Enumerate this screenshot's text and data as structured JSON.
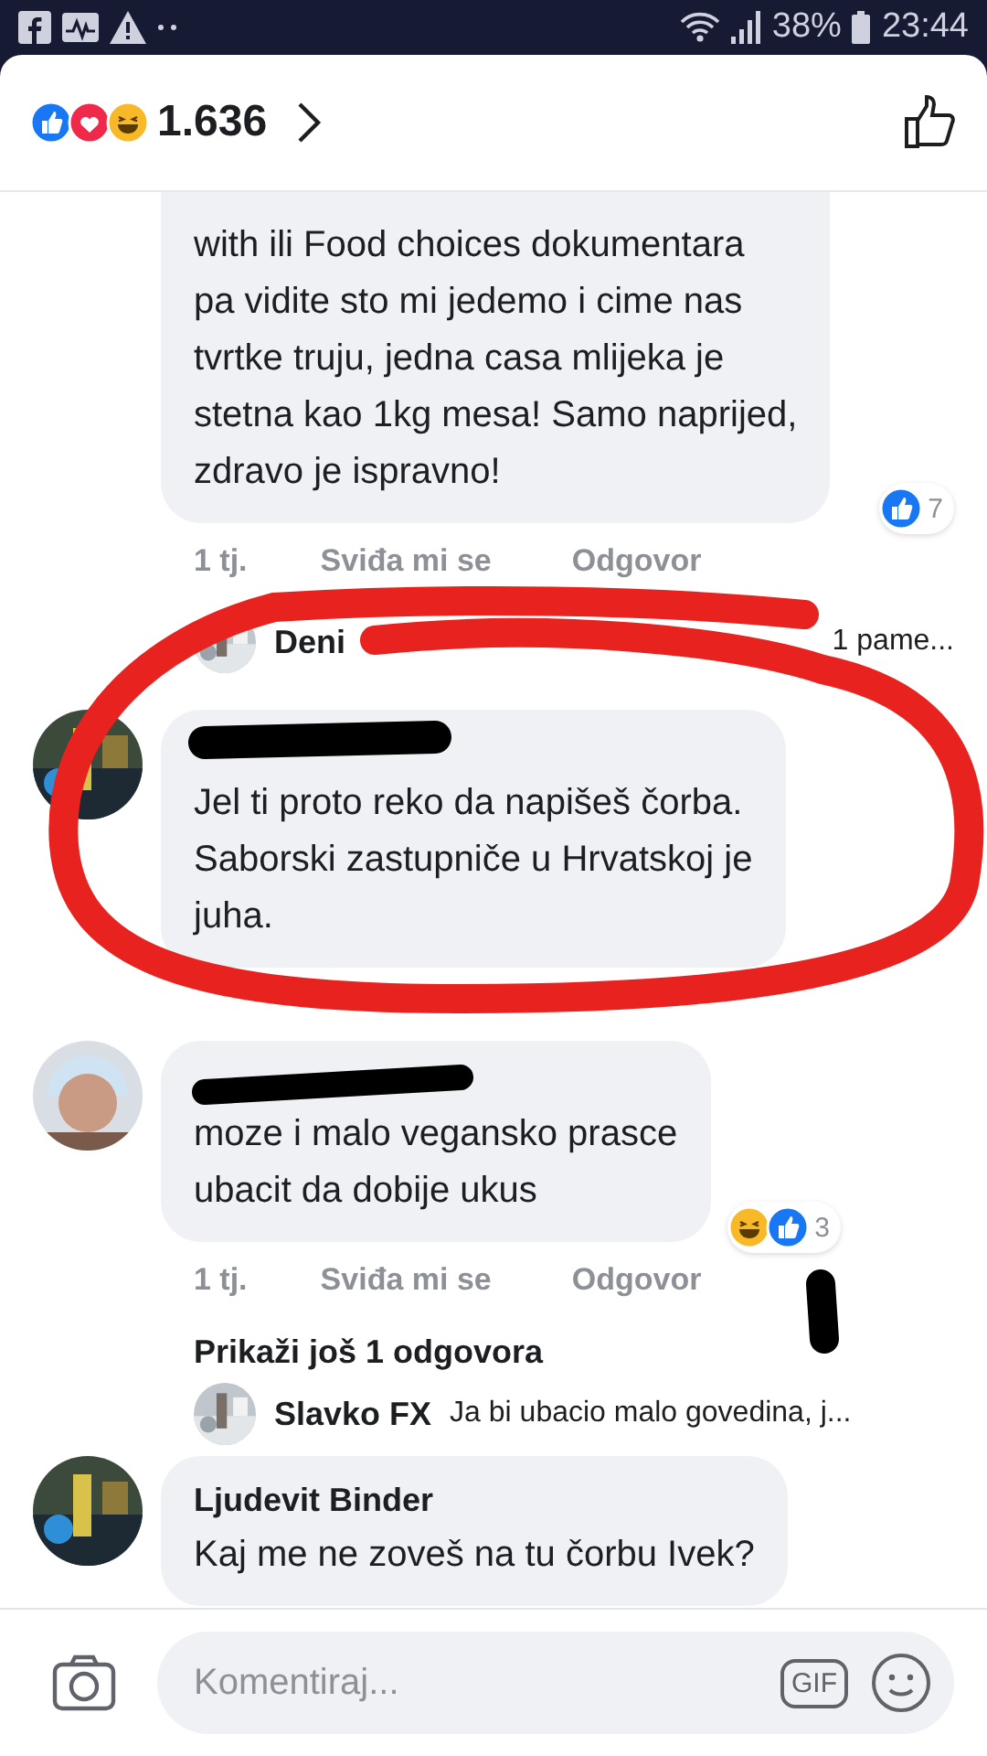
{
  "status_bar": {
    "battery": "38%",
    "time": "23:44"
  },
  "header": {
    "reaction_count": "1.636",
    "reactions": [
      {
        "kind": "like"
      },
      {
        "kind": "love"
      },
      {
        "kind": "haha"
      }
    ]
  },
  "items": [
    {
      "kind": "comment",
      "text": "with ili Food choices dokumentara\npa vidite sto mi jedemo i cime nas\ntvrtke truju, jedna casa mlijeka je\nstetna kao 1kg mesa! Samo naprijed,\nzdravo je ispravno!",
      "time": "1 tj.",
      "like_label": "Sviđa mi se",
      "reply_label": "Odgovor",
      "reactions": [
        {
          "kind": "like"
        }
      ],
      "reaction_count": "7"
    },
    {
      "kind": "reply_preview",
      "name": "Deni",
      "text": "1 pame..."
    },
    {
      "kind": "comment",
      "text": "Jel ti proto reko da napišeš čorba.\nSaborski zastupniče u Hrvatskoj je\njuha."
    },
    {
      "kind": "comment",
      "avatar": {
        "kind": "figure"
      },
      "text": "moze i malo vegansko prasce\nubacit da dobije ukus",
      "time": "1 tj.",
      "like_label": "Sviđa mi se",
      "reply_label": "Odgovor",
      "reactions": [
        {
          "kind": "haha"
        },
        {
          "kind": "like"
        }
      ],
      "reaction_count": "3"
    },
    {
      "kind": "more_replies",
      "text": "Prikaži još 1 odgovora"
    },
    {
      "kind": "reply_preview",
      "name": "Slavko FX",
      "text": "Ja bi ubacio malo govedina, j..."
    },
    {
      "kind": "comment",
      "name": "Ljudevit Binder",
      "text": "Kaj me ne zoveš na tu čorbu Ivek?"
    }
  ],
  "composer": {
    "placeholder": "Komentiraj...",
    "gif_label": "GIF"
  }
}
